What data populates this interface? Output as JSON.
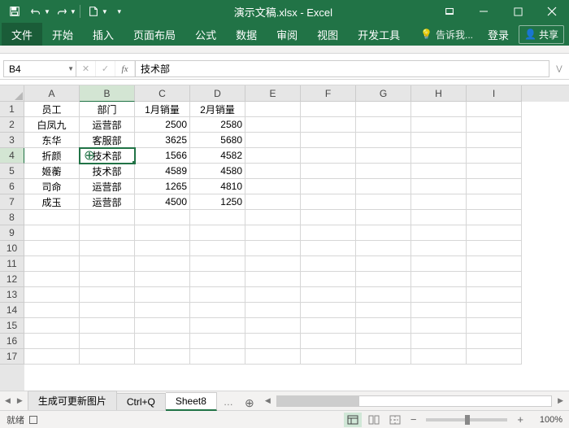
{
  "app": {
    "title": "演示文稿.xlsx - Excel"
  },
  "tabs": {
    "file": "文件",
    "home": "开始",
    "insert": "插入",
    "layout": "页面布局",
    "formulas": "公式",
    "data": "数据",
    "review": "审阅",
    "view": "视图",
    "dev": "开发工具",
    "tellme": "告诉我...",
    "login": "登录",
    "share": "共享"
  },
  "namebox": "B4",
  "formula": "技术部",
  "columns": [
    "A",
    "B",
    "C",
    "D",
    "E",
    "F",
    "G",
    "H",
    "I"
  ],
  "active_col_idx": 1,
  "active_row_idx": 3,
  "rows": 17,
  "data": [
    [
      "员工",
      "部门",
      "1月销量",
      "2月销量"
    ],
    [
      "白凤九",
      "运营部",
      "2500",
      "2580"
    ],
    [
      "东华",
      "客服部",
      "3625",
      "5680"
    ],
    [
      "折颜",
      "技术部",
      "1566",
      "4582"
    ],
    [
      "姬蘅",
      "技术部",
      "4589",
      "4580"
    ],
    [
      "司命",
      "运营部",
      "1265",
      "4810"
    ],
    [
      "成玉",
      "运营部",
      "4500",
      "1250"
    ]
  ],
  "numeric_cols": [
    2,
    3
  ],
  "sheets": {
    "s1": "生成可更新图片",
    "s2": "Ctrl+Q",
    "s3": "Sheet8"
  },
  "status": {
    "ready": "就绪",
    "zoom": "100%"
  }
}
